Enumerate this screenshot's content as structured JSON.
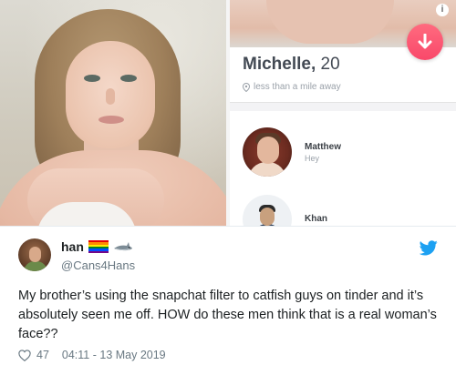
{
  "profile": {
    "name": "Michelle,",
    "age": "20",
    "distance": "less than a mile away",
    "info_icon": "info-icon",
    "dismiss_icon": "arrow-down-icon"
  },
  "matches": [
    {
      "name": "Matthew",
      "message": "Hey"
    },
    {
      "name": "Khan",
      "message": ""
    }
  ],
  "tweet": {
    "display_name": "han",
    "handle": "@Cans4Hans",
    "text": "My brother’s using the snapchat filter to catfish guys on tinder and it’s absolutely seen me off. HOW do these men think that is a real woman’s face??",
    "likes": "47",
    "timestamp": "04:11 - 13 May 2019"
  },
  "colors": {
    "tinder_accent": "#f9486a",
    "twitter_blue": "#1da1f2",
    "muted_text": "#697882"
  }
}
